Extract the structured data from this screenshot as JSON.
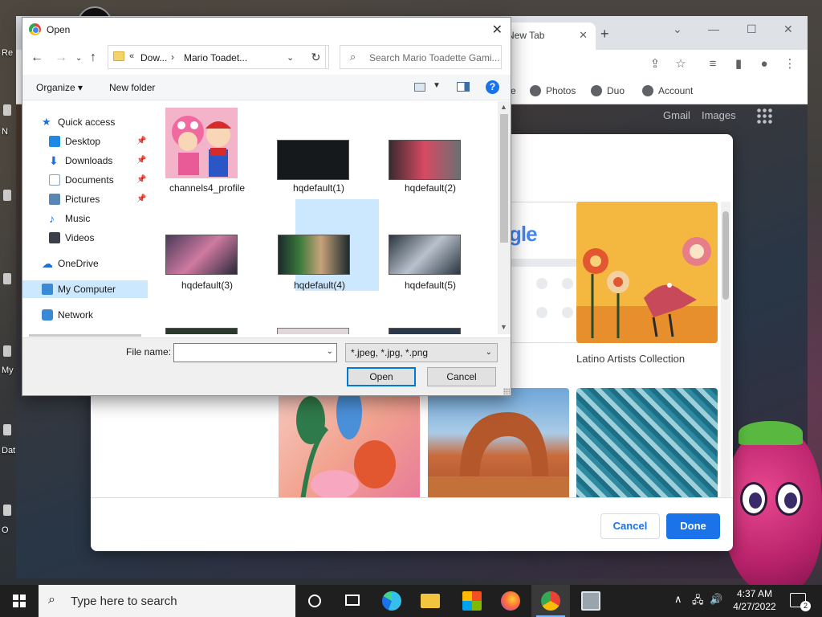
{
  "desktop": {
    "labels": [
      "Re",
      "N",
      "My",
      "Dat",
      "O"
    ]
  },
  "chrome": {
    "tab_title": "New Tab",
    "tab_close": "✕",
    "new_tab": "+",
    "bookmarks": [
      "e",
      "Photos",
      "Duo",
      "Account"
    ],
    "top_links": [
      "Gmail",
      "Images"
    ]
  },
  "customize": {
    "tiles": [
      {
        "caption": ""
      },
      {
        "caption": "Latino Artists Collection"
      }
    ],
    "google_text": "gle",
    "cancel_label": "Cancel",
    "done_label": "Done",
    "colors": {
      "primary": "#1a73e8"
    }
  },
  "open_dialog": {
    "title": "Open",
    "close": "✕",
    "breadcrumb": {
      "overflow": "«",
      "segment1": "Dow...",
      "separator": "›",
      "segment2": "Mario Toadet..."
    },
    "search_placeholder": "Search Mario Toadette Gami...",
    "toolbar": {
      "organize": "Organize ▾",
      "new_folder": "New folder",
      "help": "?"
    },
    "nav": [
      {
        "label": "Quick access",
        "icon": "star-icon",
        "color": "#1e6fd9",
        "pinned": false
      },
      {
        "label": "Desktop",
        "icon": "desktop-icon",
        "color": "#1e88e5",
        "pinned": true
      },
      {
        "label": "Downloads",
        "icon": "download-icon",
        "color": "#1e6fd9",
        "pinned": true
      },
      {
        "label": "Documents",
        "icon": "document-icon",
        "color": "#8aa4c0",
        "pinned": true
      },
      {
        "label": "Pictures",
        "icon": "pictures-icon",
        "color": "#5a86b6",
        "pinned": true
      },
      {
        "label": "Music",
        "icon": "music-icon",
        "color": "#1e6fd9",
        "pinned": false
      },
      {
        "label": "Videos",
        "icon": "videos-icon",
        "color": "#3a3f4a",
        "pinned": false
      },
      {
        "label": "OneDrive",
        "icon": "onedrive-icon",
        "color": "#1e6fd9",
        "pinned": false
      },
      {
        "label": "My Computer",
        "icon": "computer-icon",
        "color": "#3a8ad6",
        "pinned": false
      },
      {
        "label": "Network",
        "icon": "network-icon",
        "color": "#3a8ad6",
        "pinned": false
      }
    ],
    "pin_glyph": "📌",
    "files": [
      {
        "name": "channels4_profile",
        "color": "#e7a7c2"
      },
      {
        "name": "hqdefault(1)",
        "color": "#15191c"
      },
      {
        "name": "hqdefault(2)",
        "color": "#8a4a55"
      },
      {
        "name": "hqdefault(3)",
        "color": "#3a3348"
      },
      {
        "name": "hqdefault(4)",
        "color": "#1c2a2c"
      },
      {
        "name": "hqdefault(5)",
        "color": "#2a3540"
      }
    ],
    "file_name_label": "File name:",
    "file_name_value": "",
    "filter": "*.jpeg, *.jpg, *.png",
    "open_label": "Open",
    "cancel_label": "Cancel"
  },
  "taskbar": {
    "search_placeholder": "Type here to search",
    "time": "4:37 AM",
    "date": "4/27/2022",
    "notifications": "2"
  }
}
